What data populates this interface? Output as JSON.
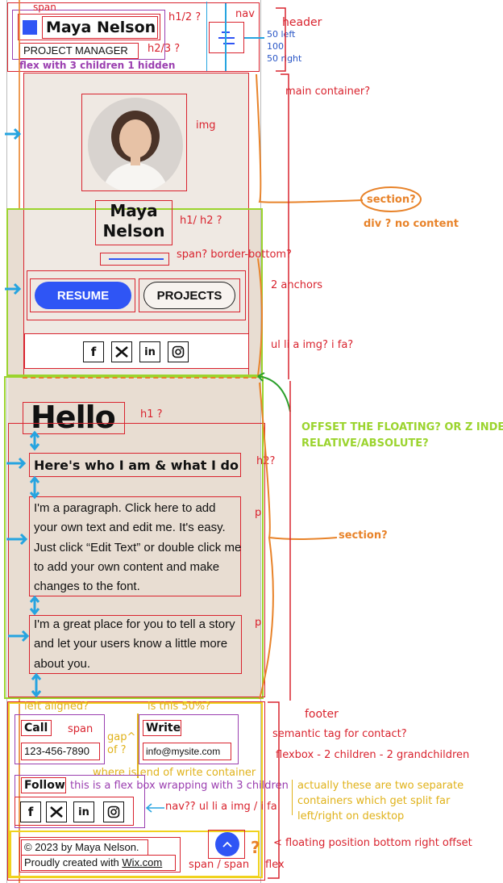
{
  "header": {
    "logo_name": "Maya Nelson",
    "title": "PROJECT MANAGER",
    "span_note": "span",
    "h1_note": "h1/2 ?",
    "h2_note": "h2/3 ?",
    "flex_note": "flex with 3 children 1 hidden",
    "nav_note": "nav",
    "nav_left": "50 left",
    "nav_mid": "100",
    "nav_right": "50 right",
    "header_note": "header"
  },
  "profile": {
    "main_container_note": "main container?",
    "img_note": "img",
    "name_line1": "Maya",
    "name_line2": "Nelson",
    "name_note": "h1/ h2 ?",
    "divider_note": "span? border-bottom?",
    "resume_label": "RESUME",
    "projects_label": "PROJECTS",
    "anchors_note": "2 anchors",
    "social_note": "ul li a img? i fa?",
    "section_note": "section?",
    "div_note": "div ? no content"
  },
  "about": {
    "hello": "Hello",
    "hello_note": "h1 ?",
    "subtitle": "Here's who I am & what I do",
    "subtitle_note": "h2?",
    "para1": "I'm a paragraph. Click here to add your own text and edit me. It's easy. Just click “Edit Text” or double click me to add your own content and make changes to the font.",
    "para2": "I'm a great place for you to tell a story and let your users know a little more about you.",
    "p_note": "p",
    "offset_note": "OFFSET THE FLOATING? OR Z INDEX RELATIVE/ABSOLUTE?",
    "section_note": "section?"
  },
  "footer": {
    "left_aligned_note": "left aligned?",
    "fifty_note": "is this 50%?",
    "footer_note": "footer",
    "call_label": "Call",
    "phone": "123-456-7890",
    "span_note": "span",
    "gap_note": "gap^ of ?",
    "write_label": "Write",
    "email": "info@mysite.com",
    "semantic_note": "semantic tag for contact?",
    "flexbox_note": "flexbox - 2 children - 2 grandchildren",
    "write_end_note": "where is end of write container",
    "follow_label": "Follow",
    "flex_wrap_note": "this is a flex box wrapping with 3 children",
    "nav_note": "nav?? ul li a img / i fa",
    "split_note_1": "actually these are two separate",
    "split_note_2": "containers which get split far",
    "split_note_3": "left/right on desktop",
    "copyright": "© 2023 by Maya Nelson.",
    "credit_prefix": "Proudly created with ",
    "credit_link": "Wix.com",
    "floating_note": "< floating position bottom right offset",
    "span_span_note": "span / span",
    "flex_note": "flex"
  },
  "icons": [
    "facebook-icon",
    "twitter-icon",
    "linkedin-icon",
    "instagram-icon",
    "chevron-up-icon",
    "hamburger-icon"
  ],
  "colors": {
    "accent": "#2f55f5",
    "annotation_red": "#d9232e",
    "annotation_orange": "#e8832a",
    "annotation_green": "#9bd42e",
    "section_bg": "#e8ddd2"
  }
}
